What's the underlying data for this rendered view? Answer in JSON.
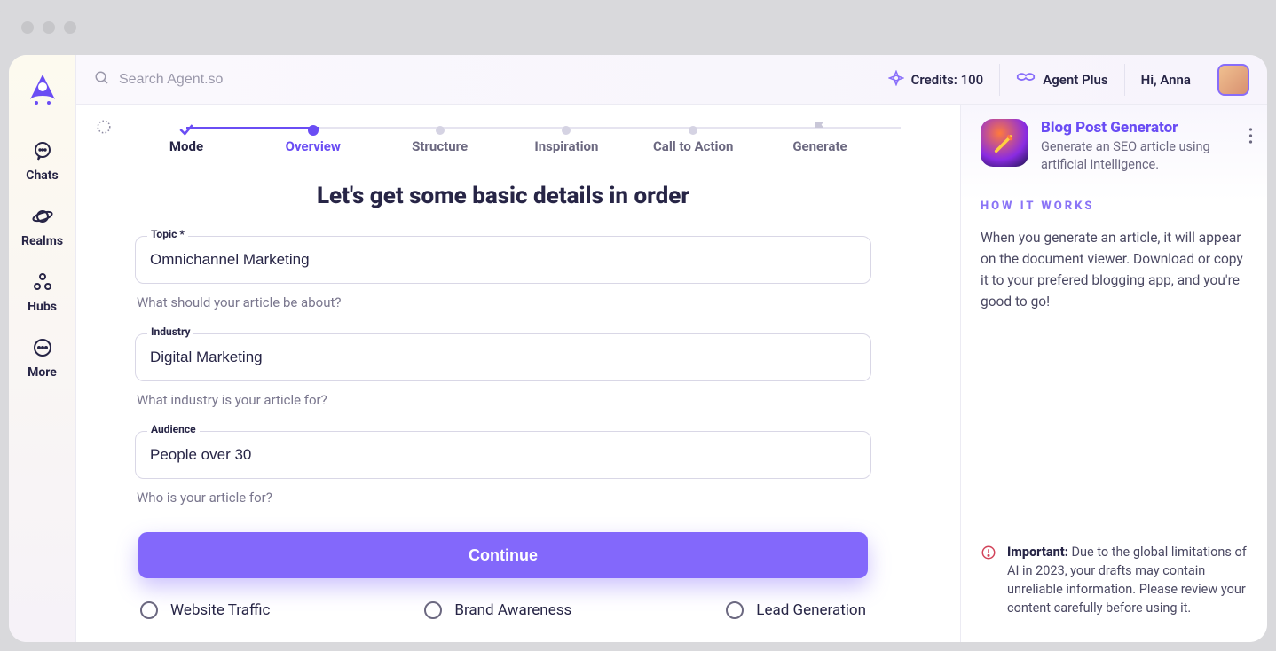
{
  "sidebar": {
    "items": [
      {
        "label": "Chats"
      },
      {
        "label": "Realms"
      },
      {
        "label": "Hubs"
      },
      {
        "label": "More"
      }
    ]
  },
  "header": {
    "search_placeholder": "Search Agent.so",
    "credits_label": "Credits:",
    "credits_value": "100",
    "plus_label": "Agent Plus",
    "greeting": "Hi, Anna"
  },
  "stepper": {
    "steps": [
      {
        "label": "Mode"
      },
      {
        "label": "Overview"
      },
      {
        "label": "Structure"
      },
      {
        "label": "Inspiration"
      },
      {
        "label": "Call to Action"
      },
      {
        "label": "Generate"
      }
    ]
  },
  "form": {
    "title": "Let's get some basic details in order",
    "topic_label": "Topic",
    "topic_required": "*",
    "topic_value": "Omnichannel Marketing",
    "topic_help": "What should your article be about?",
    "industry_label": "Industry",
    "industry_value": "Digital Marketing",
    "industry_help": "What industry is your article for?",
    "audience_label": "Audience",
    "audience_value": "People over 30",
    "audience_help": "Who is your article for?",
    "continue_label": "Continue",
    "goals": [
      {
        "label": "Website Traffic"
      },
      {
        "label": "Brand Awareness"
      },
      {
        "label": "Lead Generation"
      }
    ]
  },
  "panel": {
    "app_title": "Blog Post Generator",
    "app_sub": "Generate an SEO article using artificial intelligence.",
    "hiw_label": "HOW IT WORKS",
    "hiw_text": "When you generate an article, it will appear on the document viewer. Download or copy it to your prefered blogging app, and you're good to go!",
    "important_label": "Important:",
    "important_text": " Due to the global limitations of AI in 2023, your drafts may contain unreliable information. Please review your content carefully before using it."
  }
}
